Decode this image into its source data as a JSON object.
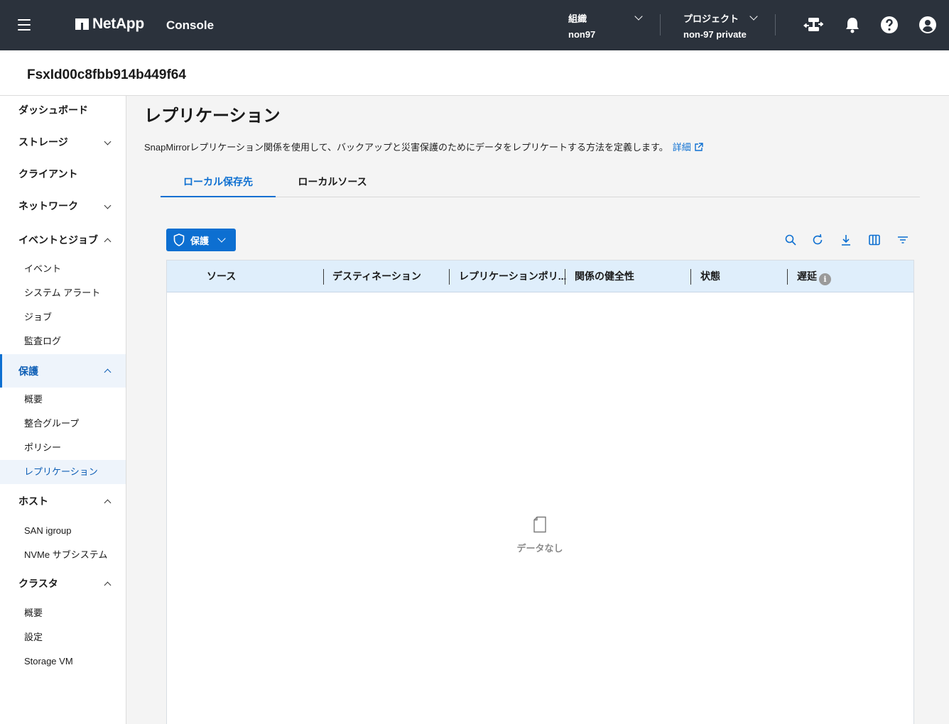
{
  "topbar": {
    "brand": "NetApp",
    "console_label": "Console",
    "org": {
      "label": "組織",
      "value": "non97"
    },
    "project": {
      "label": "プロジェクト",
      "value": "non-97 private"
    },
    "icons": [
      "menu-icon",
      "connector-icon",
      "bell-icon",
      "help-icon",
      "user-icon"
    ]
  },
  "subheader": {
    "title": "FsxId00c8fbb914b449f64"
  },
  "sidebar": {
    "dashboard": "ダッシュボード",
    "storage": "ストレージ",
    "clients": "クライアント",
    "network": "ネットワーク",
    "events_jobs": "イベントとジョブ",
    "events_jobs_items": [
      "イベント",
      "システム アラート",
      "ジョブ",
      "監査ログ"
    ],
    "protection": "保護",
    "protection_items": [
      "概要",
      "整合グループ",
      "ポリシー",
      "レプリケーション"
    ],
    "hosts": "ホスト",
    "hosts_items": [
      "SAN igroup",
      "NVMe サブシステム"
    ],
    "cluster": "クラスタ",
    "cluster_items": [
      "概要",
      "設定",
      "Storage VM"
    ]
  },
  "main": {
    "title": "レプリケーション",
    "description": "SnapMirrorレプリケーション関係を使用して、バックアップと災害保護のためにデータをレプリケートする方法を定義します。",
    "details_link": "詳細",
    "tabs": [
      "ローカル保存先",
      "ローカルソース"
    ],
    "protect_button": "保護",
    "columns": [
      "ソース",
      "デスティネーション",
      "レプリケーションポリ...",
      "関係の健全性",
      "状態",
      "遅延"
    ],
    "empty_text": "データなし"
  },
  "colors": {
    "topbar": "#2b323c",
    "accent": "#0d6fd1",
    "table_header": "#dfeefb"
  }
}
